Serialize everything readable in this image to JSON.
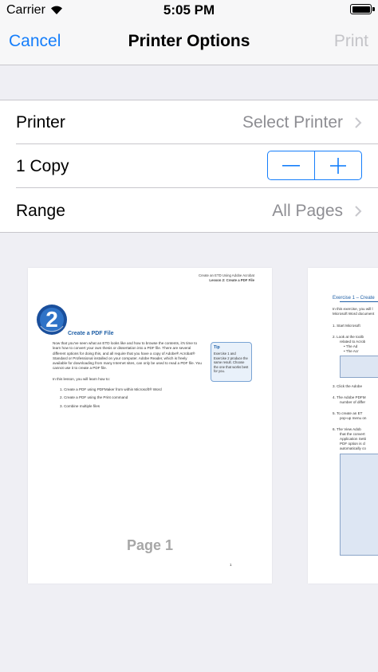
{
  "status_bar": {
    "carrier": "Carrier",
    "time": "5:05 PM"
  },
  "nav": {
    "cancel": "Cancel",
    "title": "Printer Options",
    "print": "Print"
  },
  "options": {
    "printer": {
      "label": "Printer",
      "value": "Select Printer"
    },
    "copies": {
      "label": "1 Copy"
    },
    "range": {
      "label": "Range",
      "value": "All Pages"
    }
  },
  "colors": {
    "accent": "#157efb",
    "disabled": "#c4c4c8",
    "secondary_text": "#8e8e93",
    "background": "#efeff4",
    "doc_blue": "#1f5fa6"
  },
  "preview": {
    "page1": {
      "header_line1": "Create an ETD Using Adobe Acrobat",
      "header_line2": "Lesson 2: Create a PDF File",
      "logo_number": "2",
      "title": "Create a PDF File",
      "intro": "Now that you've seen what an ETD looks like and how to browse the contents, it's time to learn how to convert your own thesis or dissertation into a PDF file. There are several different options for doing this, and all require that you have a copy of Adobe® Acrobat® Standard or Professional installed on your computer. Adobe Reader, which is freely available for downloading from many Internet sites, can only be used to read a PDF file. You cannot use it to create a PDF file.",
      "lesson_intro": "In this lesson, you will learn how to:",
      "list": [
        "1.  Create a PDF using PDFMaker from within Microsoft® Word",
        "2.  Create a PDF using the Print command",
        "3.  Combine multiple files"
      ],
      "tip_title": "Tip",
      "tip_body": "Exercise 1 and Exercise 2 produce the same result. Choose the one that works best for you.",
      "page_label": "Page 1",
      "page_number": "1"
    },
    "page2": {
      "title": "Exercise 1 – Create",
      "lines": [
        "In this exercise, you will l",
        "Microsoft Word document",
        "1.  Start Microsoft",
        "2.  Look at the toolb",
        "related to Acrob",
        "• The Ad",
        "• The Acr",
        "3.  Click the Adobe",
        "4.  The Adobe PDFM",
        "number of differ",
        "5.  To create an ET",
        "pop-up menu on",
        "6.  The View Adob",
        "that the convert",
        "Application Setti",
        "PDF option is cl",
        "automatically co"
      ]
    }
  }
}
